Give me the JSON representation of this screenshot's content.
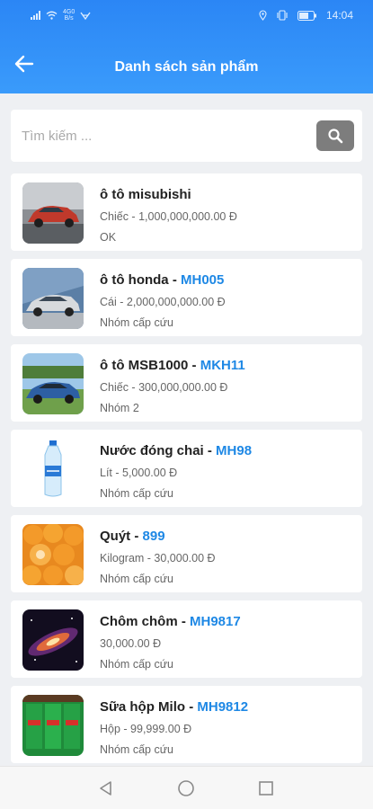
{
  "status_bar": {
    "network_top": "4G0",
    "network_bottom": "B/s",
    "time": "14:04",
    "icons": [
      "signal-icon",
      "wifi-icon",
      "hd-icon",
      "location-icon",
      "vibrate-icon",
      "battery-icon"
    ]
  },
  "header": {
    "title": "Danh sách sản phẩm",
    "back_icon": "arrow-left-icon",
    "background": "#3a9bfb"
  },
  "search": {
    "placeholder": "Tìm kiếm ...",
    "value": "",
    "icon": "search-icon"
  },
  "products": [
    {
      "name": "ô tô misubishi",
      "code_sep": "",
      "code": "",
      "unit_price": "Chiếc - 1,000,000,000.00 Đ",
      "group": "OK",
      "image": "red-suv"
    },
    {
      "name": "ô tô honda",
      "code_sep": " - ",
      "code": "MH005",
      "unit_price": "Cái - 2,000,000,000.00 Đ",
      "group": "Nhóm cấp cứu",
      "image": "silver-car"
    },
    {
      "name": "ô tô MSB1000",
      "code_sep": " - ",
      "code": "MKH11",
      "unit_price": "Chiếc - 300,000,000.00 Đ",
      "group": "Nhóm 2",
      "image": "blue-car"
    },
    {
      "name": "Nước đóng chai",
      "code_sep": " - ",
      "code": "MH98",
      "unit_price": "Lít - 5,000.00 Đ",
      "group": "Nhóm cấp cứu",
      "image": "water-bottle"
    },
    {
      "name": "Quýt",
      "code_sep": " - ",
      "code": "899",
      "unit_price": "Kilogram - 30,000.00 Đ",
      "group": "Nhóm cấp cứu",
      "image": "tangerines"
    },
    {
      "name": "Chôm chôm",
      "code_sep": " - ",
      "code": "MH9817",
      "unit_price": "30,000.00 Đ",
      "group": "Nhóm cấp cứu",
      "image": "galaxy"
    },
    {
      "name": "Sữa hộp Milo",
      "code_sep": " - ",
      "code": "MH9812",
      "unit_price": "Hộp - 99,999.00 Đ",
      "group": "Nhóm cấp cứu",
      "image": "milo-box"
    }
  ],
  "colors": {
    "accent": "#1e88e5",
    "header": "#3a9bfb",
    "search_button": "#7d7d7d",
    "background": "#eef0f3"
  },
  "nav_bar": {
    "icons": [
      "back-triangle-icon",
      "home-circle-icon",
      "recents-square-icon"
    ]
  }
}
